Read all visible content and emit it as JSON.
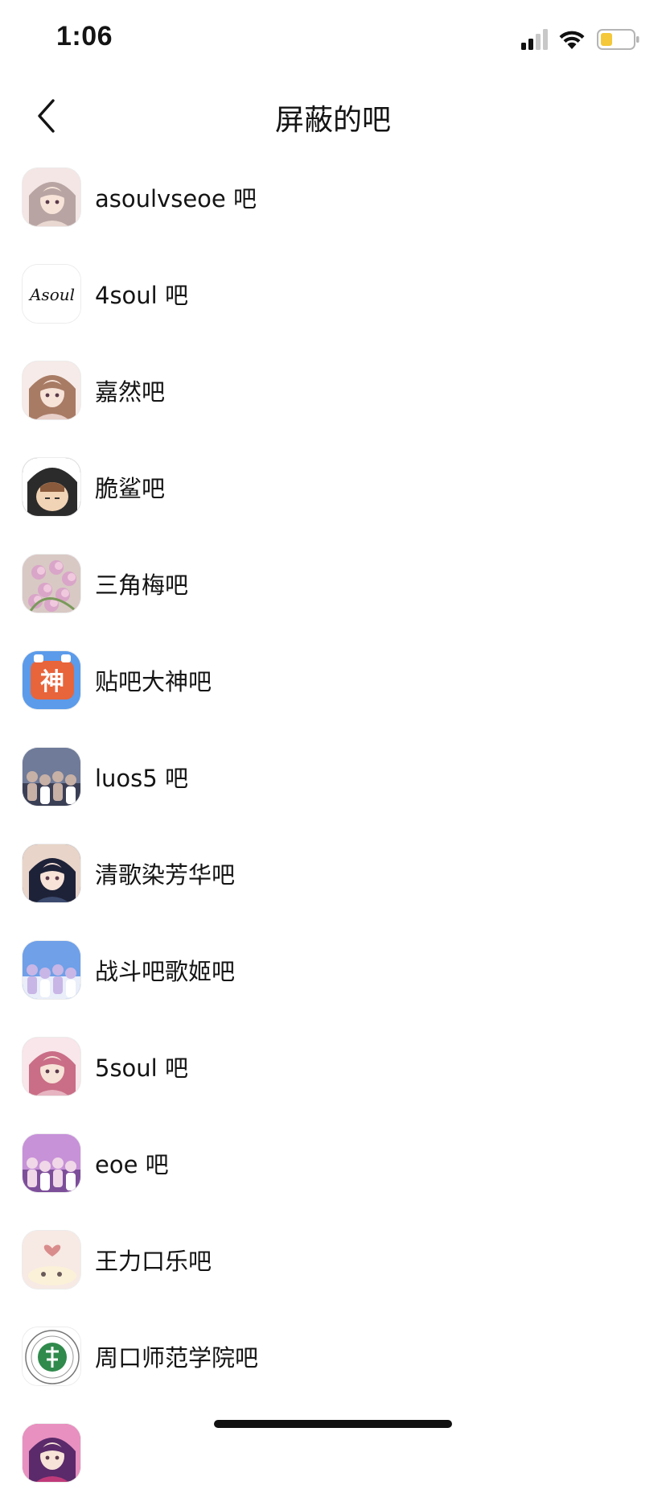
{
  "status_bar": {
    "time": "1:06",
    "battery_color": "#f4c838"
  },
  "nav": {
    "title": "屏蔽的吧",
    "back_icon": "chevron-left-icon"
  },
  "list": [
    {
      "name": "asoulvseoe 吧",
      "avatar": "anime-girl-avatar",
      "colors": [
        "#e9d7d2",
        "#b8a5a3",
        "#f3e6e4"
      ]
    },
    {
      "name": "4soul 吧",
      "avatar": "asoul-logo-avatar",
      "logo_text": "Asoul",
      "colors": [
        "#ffffff",
        "#111111",
        "#ffffff"
      ]
    },
    {
      "name": "嘉然吧",
      "avatar": "anime-girl-avatar",
      "colors": [
        "#e8cfc8",
        "#a87b65",
        "#f6ebe8"
      ]
    },
    {
      "name": "脆鲨吧",
      "avatar": "shark-girl-avatar",
      "colors": [
        "#2b2b2b",
        "#f1d3b5",
        "#ffffff"
      ]
    },
    {
      "name": "三角梅吧",
      "avatar": "flower-avatar",
      "colors": [
        "#d9a5c8",
        "#7a9a5b",
        "#f0c9de"
      ]
    },
    {
      "name": "贴吧大神吧",
      "avatar": "shen-badge-avatar",
      "badge_text": "神",
      "colors": [
        "#5b9bea",
        "#e8643a",
        "#ffffff"
      ]
    },
    {
      "name": "luos5 吧",
      "avatar": "group-photo-avatar",
      "colors": [
        "#6f7b99",
        "#3a3f55",
        "#c7b0a6"
      ]
    },
    {
      "name": "清歌染芳华吧",
      "avatar": "dark-hair-girl-avatar",
      "colors": [
        "#3b4a6e",
        "#1e2238",
        "#e8d4c9"
      ]
    },
    {
      "name": "战斗吧歌姬吧",
      "avatar": "group-anime-avatar",
      "colors": [
        "#6fa0e8",
        "#e9eef9",
        "#c8b6e6"
      ]
    },
    {
      "name": "5soul 吧",
      "avatar": "anime-girl-avatar",
      "colors": [
        "#e7b4c1",
        "#c96e86",
        "#f8e6ea"
      ]
    },
    {
      "name": "eoe 吧",
      "avatar": "group-anime-avatar",
      "colors": [
        "#c792d8",
        "#7d4f9a",
        "#f0d8e8"
      ]
    },
    {
      "name": "王力口乐吧",
      "avatar": "cartoon-avatar",
      "colors": [
        "#f7e9e4",
        "#d98c8c",
        "#ffffff"
      ]
    },
    {
      "name": "周口师范学院吧",
      "avatar": "university-seal-avatar",
      "seal_text": "周口师范学院",
      "colors": [
        "#ffffff",
        "#2f8a4c",
        "#ffffff"
      ]
    },
    {
      "name": "",
      "avatar": "anime-girl-avatar",
      "colors": [
        "#c03a7a",
        "#5a2a6a",
        "#e890c0"
      ]
    }
  ]
}
